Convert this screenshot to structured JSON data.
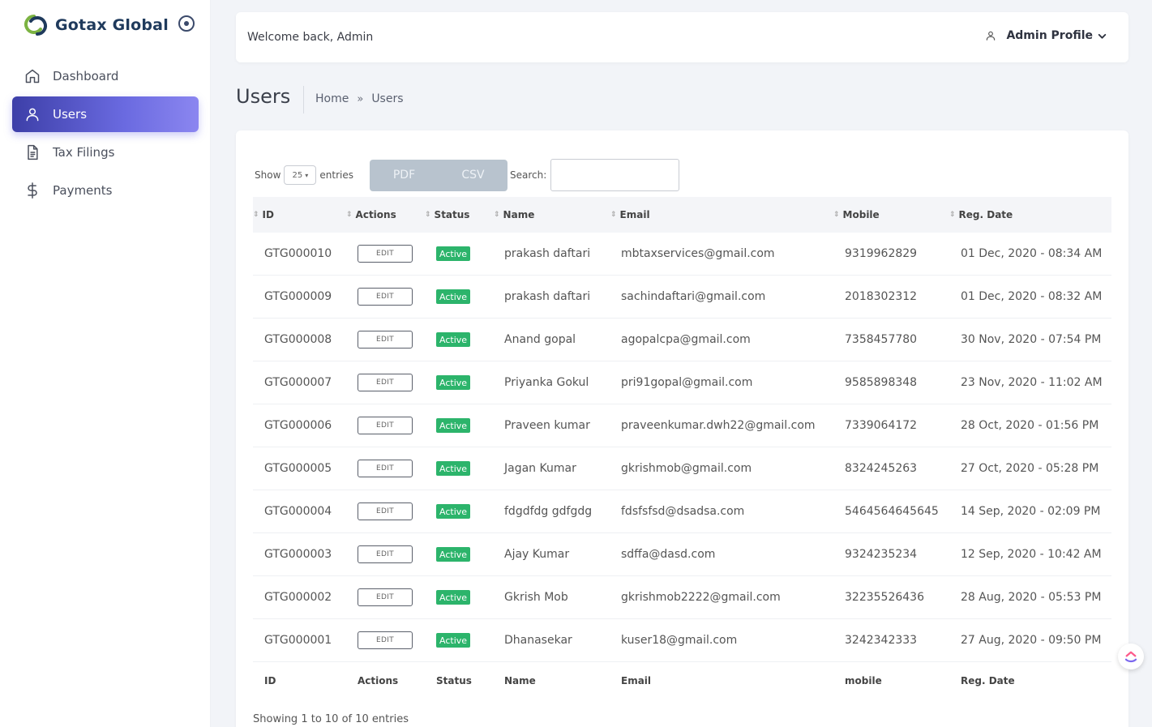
{
  "brand": {
    "name": "Gotax Global",
    "logo_icon": "gotax-logo-icon",
    "toggle_icon": "radio-circle-icon"
  },
  "sidebar": {
    "items": [
      {
        "label": "Dashboard",
        "icon": "home-icon",
        "active": false
      },
      {
        "label": "Users",
        "icon": "user-icon",
        "active": true
      },
      {
        "label": "Tax Filings",
        "icon": "document-icon",
        "active": false
      },
      {
        "label": "Payments",
        "icon": "dollar-icon",
        "active": false
      }
    ]
  },
  "header": {
    "welcome": "Welcome back, Admin",
    "profile_label": "Admin Profile"
  },
  "page": {
    "title": "Users",
    "breadcrumb": [
      "Home",
      "Users"
    ],
    "breadcrumb_sep": "»"
  },
  "controls": {
    "show_label": "Show",
    "entries_value": "25",
    "entries_label": "entries",
    "pdf_label": "PDF",
    "csv_label": "CSV",
    "search_label": "Search:",
    "search_value": ""
  },
  "table": {
    "headers": [
      "ID",
      "Actions",
      "Status",
      "Name",
      "Email",
      "Mobile",
      "Reg. Date"
    ],
    "footers": [
      "ID",
      "Actions",
      "Status",
      "Name",
      "Email",
      "mobile",
      "Reg. Date"
    ],
    "edit_label": "EDIT",
    "rows": [
      {
        "id": "GTG000010",
        "status": "Active",
        "name": "prakash daftari",
        "email": "mbtaxservices@gmail.com",
        "mobile": "9319962829",
        "date": "01 Dec, 2020 - 08:34 AM"
      },
      {
        "id": "GTG000009",
        "status": "Active",
        "name": "prakash daftari",
        "email": "sachindaftari@gmail.com",
        "mobile": "2018302312",
        "date": "01 Dec, 2020 - 08:32 AM"
      },
      {
        "id": "GTG000008",
        "status": "Active",
        "name": "Anand gopal",
        "email": "agopalcpa@gmail.com",
        "mobile": "7358457780",
        "date": "30 Nov, 2020 - 07:54 PM"
      },
      {
        "id": "GTG000007",
        "status": "Active",
        "name": "Priyanka Gokul",
        "email": "pri91gopal@gmail.com",
        "mobile": "9585898348",
        "date": "23 Nov, 2020 - 11:02 AM"
      },
      {
        "id": "GTG000006",
        "status": "Active",
        "name": "Praveen kumar",
        "email": "praveenkumar.dwh22@gmail.com",
        "mobile": "7339064172",
        "date": "28 Oct, 2020 - 01:56 PM"
      },
      {
        "id": "GTG000005",
        "status": "Active",
        "name": "Jagan Kumar",
        "email": "gkrishmob@gmail.com",
        "mobile": "8324245263",
        "date": "27 Oct, 2020 - 05:28 PM"
      },
      {
        "id": "GTG000004",
        "status": "Active",
        "name": "fdgdfdg gdfgdg",
        "email": "fdsfsfsd@dsadsa.com",
        "mobile": "5464564645645",
        "date": "14 Sep, 2020 - 02:09 PM"
      },
      {
        "id": "GTG000003",
        "status": "Active",
        "name": "Ajay Kumar",
        "email": "sdffa@dasd.com",
        "mobile": "9324235234",
        "date": "12 Sep, 2020 - 10:42 AM"
      },
      {
        "id": "GTG000002",
        "status": "Active",
        "name": "Gkrish Mob",
        "email": "gkrishmob2222@gmail.com",
        "mobile": "32235526436",
        "date": "28 Aug, 2020 - 05:53 PM"
      },
      {
        "id": "GTG000001",
        "status": "Active",
        "name": "Dhanasekar",
        "email": "kuser18@gmail.com",
        "mobile": "3242342333",
        "date": "27 Aug, 2020 - 09:50 PM"
      }
    ],
    "info": "Showing 1 to 10 of 10 entries"
  },
  "colors": {
    "accent": "#5b5bd6",
    "badge": "#2cb46b",
    "export_btn": "#b8c3ce"
  },
  "widget": {
    "icon": "clickup-icon"
  }
}
